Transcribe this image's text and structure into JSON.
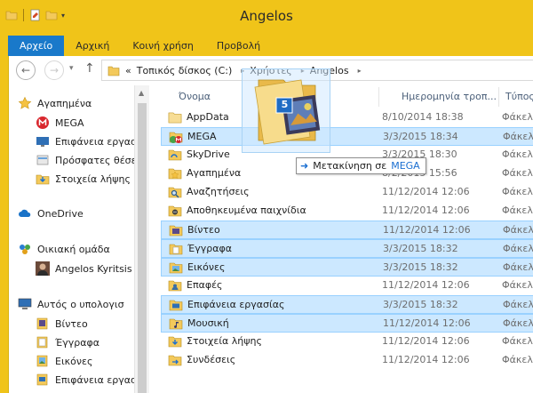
{
  "window": {
    "title": "Angelos"
  },
  "ribbon": {
    "tabs": [
      {
        "label": "Αρχείο",
        "active": true
      },
      {
        "label": "Αρχική",
        "active": false
      },
      {
        "label": "Κοινή χρήση",
        "active": false
      },
      {
        "label": "Προβολή",
        "active": false
      }
    ]
  },
  "address": {
    "overflow": "«",
    "crumbs": [
      "Τοπικός δίσκος (C:)",
      "Χρήστες",
      "Angelos"
    ]
  },
  "nav": {
    "favorites_label": "Αγαπημένα",
    "favorites": [
      "MEGA",
      "Επιφάνεια εργασ",
      "Πρόσφατες θέσε",
      "Στοιχεία λήψης"
    ],
    "onedrive_label": "OneDrive",
    "homegroup_label": "Οικιακή ομάδα",
    "homegroup_user": "Angelos Kyritsis",
    "computer_label": "Αυτός ο υπολογισ",
    "computer": [
      "Βίντεο",
      "Έγγραφα",
      "Εικόνες",
      "Επιφάνεια εργασ"
    ]
  },
  "columns": {
    "name": "Όνομα",
    "date": "Ημερομηνία τροπ...",
    "type": "Τύπος"
  },
  "files": [
    {
      "name": "AppData",
      "date": "8/10/2014 18:38",
      "type": "Φάκελ",
      "icon": "folder-hidden",
      "selected": false
    },
    {
      "name": "MEGA",
      "date": "3/3/2015 18:34",
      "type": "Φάκελ",
      "icon": "mega-folder",
      "selected": true
    },
    {
      "name": "SkyDrive",
      "date": "3/3/2015 18:30",
      "type": "Φάκελ",
      "icon": "folder-sync",
      "selected": false
    },
    {
      "name": "Αγαπημένα",
      "date": "8/2/2015 15:56",
      "type": "Φάκελ",
      "icon": "star-folder",
      "selected": false
    },
    {
      "name": "Αναζητήσεις",
      "date": "11/12/2014 12:06",
      "type": "Φάκελ",
      "icon": "search-folder",
      "selected": false
    },
    {
      "name": "Αποθηκευμένα παιχνίδια",
      "date": "11/12/2014 12:06",
      "type": "Φάκελ",
      "icon": "games-folder",
      "selected": false
    },
    {
      "name": "Βίντεο",
      "date": "11/12/2014 12:06",
      "type": "Φάκελ",
      "icon": "video-folder",
      "selected": true
    },
    {
      "name": "Έγγραφα",
      "date": "3/3/2015 18:32",
      "type": "Φάκελ",
      "icon": "documents-folder",
      "selected": true
    },
    {
      "name": "Εικόνες",
      "date": "3/3/2015 18:32",
      "type": "Φάκελ",
      "icon": "pictures-folder",
      "selected": true
    },
    {
      "name": "Επαφές",
      "date": "11/12/2014 12:06",
      "type": "Φάκελ",
      "icon": "contacts-folder",
      "selected": false
    },
    {
      "name": "Επιφάνεια εργασίας",
      "date": "3/3/2015 18:32",
      "type": "Φάκελ",
      "icon": "desktop-folder",
      "selected": true
    },
    {
      "name": "Μουσική",
      "date": "11/12/2014 12:06",
      "type": "Φάκελ",
      "icon": "music-folder",
      "selected": true
    },
    {
      "name": "Στοιχεία λήψης",
      "date": "11/12/2014 12:06",
      "type": "Φάκελ",
      "icon": "downloads-folder",
      "selected": false
    },
    {
      "name": "Συνδέσεις",
      "date": "11/12/2014 12:06",
      "type": "Φάκελ",
      "icon": "links-folder",
      "selected": false
    }
  ],
  "drag": {
    "count": "5",
    "action": "Μετακίνηση σε",
    "target": "MEGA"
  },
  "colors": {
    "accent": "#1979ca",
    "titlebar": "#f0c419",
    "selection": "#cce8ff",
    "folder": "#f3c95b"
  }
}
